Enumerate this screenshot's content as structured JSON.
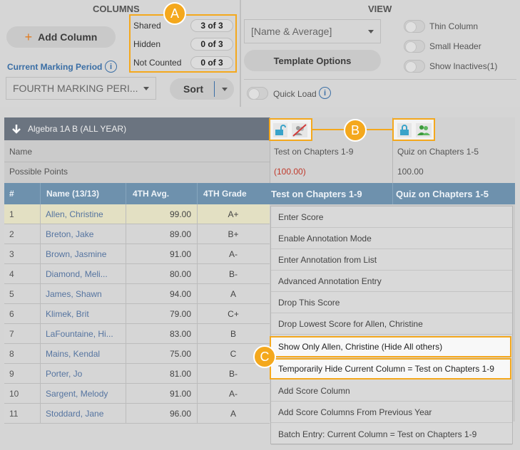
{
  "toolbar": {
    "columns_title": "COLUMNS",
    "view_title": "VIEW",
    "add_column_label": "Add Column",
    "add_icon": "+",
    "counts": [
      {
        "label": "Shared",
        "value": "3 of 3"
      },
      {
        "label": "Hidden",
        "value": "0 of 3"
      },
      {
        "label": "Not Counted",
        "value": "0 of 3"
      }
    ],
    "marking_period_label": "Current Marking Period",
    "marking_period_value": "FOURTH MARKING PERI...",
    "sort_label": "Sort",
    "view_select_value": "[Name & Average]",
    "template_options_label": "Template Options",
    "toggles": [
      "Thin Column",
      "Small Header",
      "Show Inactives(1)"
    ],
    "quick_load_label": "Quick Load",
    "info_glyph": "i"
  },
  "grid": {
    "class_name": "Algebra 1A B (ALL YEAR)",
    "name_label": "Name",
    "possible_points_label": "Possible Points",
    "columns": [
      "#",
      "Name (13/13)",
      "4TH Avg.",
      "4TH Grade"
    ],
    "assignments": [
      {
        "title": "Test on Chapters 1-9",
        "points": "(100.00)",
        "header": "Test on Chapters 1-9"
      },
      {
        "title": "Quiz on Chapters 1-5",
        "points": "100.00",
        "header": "Quiz on Chapters 1-5"
      }
    ],
    "rows": [
      {
        "num": "1",
        "name": "Allen, Christine",
        "avg": "99.00",
        "grade": "A+"
      },
      {
        "num": "2",
        "name": "Breton, Jake",
        "avg": "89.00",
        "grade": "B+"
      },
      {
        "num": "3",
        "name": "Brown, Jasmine",
        "avg": "91.00",
        "grade": "A-"
      },
      {
        "num": "4",
        "name": "Diamond, Meli...",
        "avg": "80.00",
        "grade": "B-"
      },
      {
        "num": "5",
        "name": "James, Shawn",
        "avg": "94.00",
        "grade": "A"
      },
      {
        "num": "6",
        "name": "Klimek, Brit",
        "avg": "79.00",
        "grade": "C+"
      },
      {
        "num": "7",
        "name": "LaFountaine, Hi...",
        "avg": "83.00",
        "grade": "B"
      },
      {
        "num": "8",
        "name": "Mains, Kendal",
        "avg": "75.00",
        "grade": "C"
      },
      {
        "num": "9",
        "name": "Porter, Jo",
        "avg": "81.00",
        "grade": "B-"
      },
      {
        "num": "10",
        "name": "Sargent, Melody",
        "avg": "91.00",
        "grade": "A-"
      },
      {
        "num": "11",
        "name": "Stoddard, Jane",
        "avg": "96.00",
        "grade": "A"
      }
    ]
  },
  "context_menu": {
    "items": [
      "Enter Score",
      "Enable Annotation Mode",
      "Enter Annotation from List",
      "Advanced Annotation Entry",
      "Drop This Score",
      "Drop Lowest Score for Allen, Christine",
      "Show Only Allen, Christine (Hide All others)",
      "Temporarily Hide Current Column = Test on Chapters 1-9",
      "Add Score Column",
      "Add Score Columns From Previous Year",
      "Batch Entry: Current Column = Test on Chapters 1-9"
    ]
  },
  "callouts": {
    "a": "A",
    "b": "B",
    "c": "C"
  },
  "colors": {
    "accent": "#f4a81d",
    "link": "#3a6ea5",
    "header_blue": "#6e91ad",
    "header_dark": "#6b7480",
    "points_red": "#c0392b"
  }
}
